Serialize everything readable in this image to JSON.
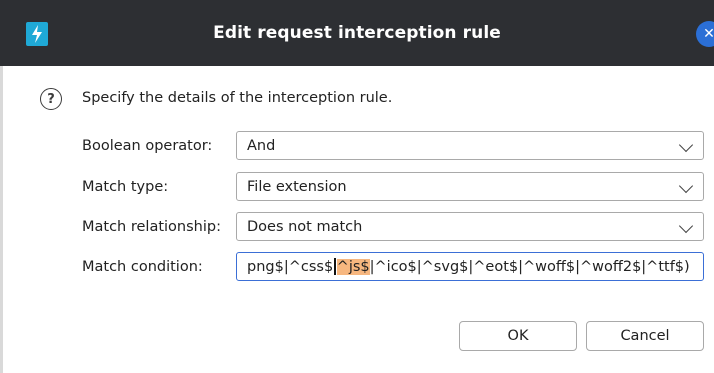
{
  "dialog": {
    "title": "Edit request interception rule",
    "instructions": "Specify the details of the interception rule."
  },
  "form": {
    "boolean_operator": {
      "label": "Boolean operator:",
      "value": "And"
    },
    "match_type": {
      "label": "Match type:",
      "value": "File extension"
    },
    "match_relationship": {
      "label": "Match relationship:",
      "value": "Does not match"
    },
    "match_condition": {
      "label": "Match condition:",
      "value_before": "png$|^css$",
      "value_highlight": "^js$",
      "value_after": "|^ico$|^svg$|^eot$|^woff$|^woff2$|^ttf$)"
    }
  },
  "buttons": {
    "ok": "OK",
    "cancel": "Cancel"
  },
  "icons": {
    "app": "burp-suite-icon",
    "help": "help-icon",
    "close": "close-icon"
  },
  "colors": {
    "titlebar": "#2d2f33",
    "accent": "#2b6fd6",
    "highlight": "#f7b77f",
    "app_icon": "#1fa9d6"
  }
}
